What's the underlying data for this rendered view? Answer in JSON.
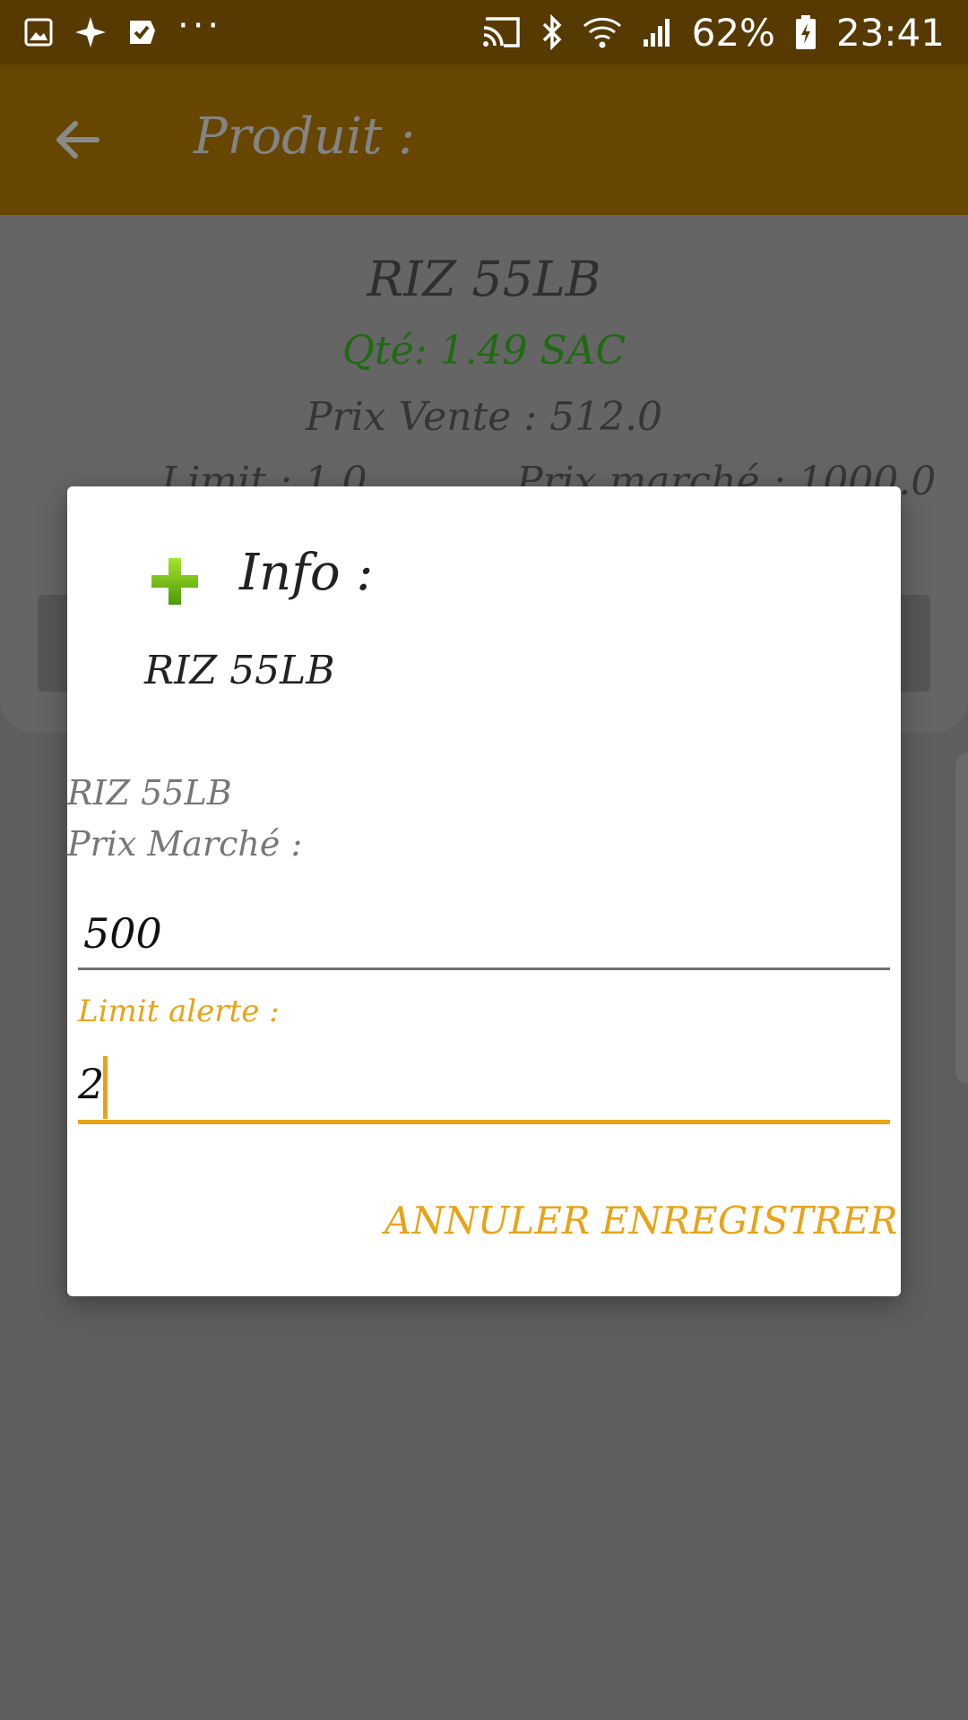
{
  "status_bar": {
    "icons": [
      "gallery-icon",
      "app-icon",
      "checklist-icon",
      "cast-icon",
      "bluetooth-icon",
      "wifi-icon",
      "signal-icon",
      "battery-icon"
    ],
    "more": "···",
    "battery": "62%",
    "time": "23:41"
  },
  "toolbar": {
    "back_icon": "arrow-back-icon",
    "title": "Produit :",
    "color": "#ffa000"
  },
  "product": {
    "name": "RIZ 55LB",
    "quantity": "Qté: 1.49 SAC",
    "sale_price": "Prix Vente : 512.0",
    "limit": "Limit : 1.0",
    "market_price": "Prix marché : 1000.0"
  },
  "dialog": {
    "icon": "plus-icon",
    "title": "Info :",
    "message": "RIZ 55LB",
    "field_heading": "RIZ 55LB",
    "market_label": "Prix Marché :",
    "market_value": "500",
    "limit_label": "Limit alerte :",
    "limit_value": "2",
    "cancel_label": "ANNULER",
    "save_label": "ENREGISTRER",
    "accent_color": "#e8a317"
  }
}
